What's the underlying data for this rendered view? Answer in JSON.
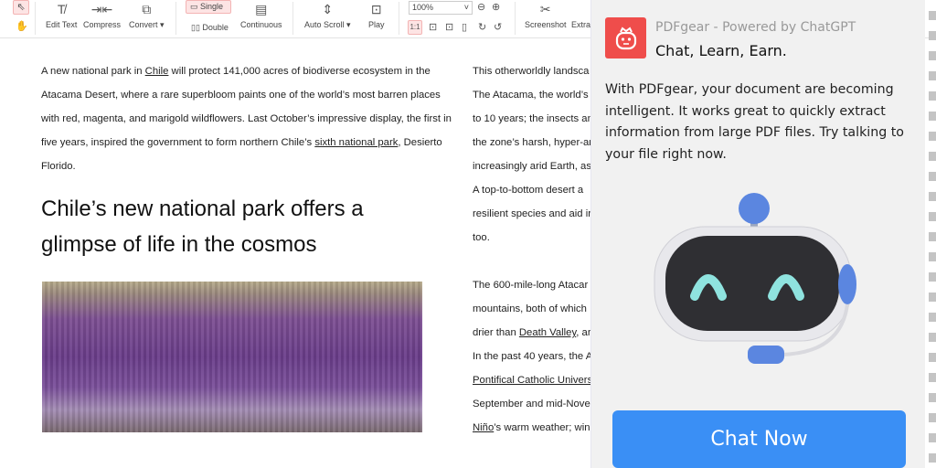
{
  "toolbar": {
    "edit_text": "Edit Text",
    "compress": "Compress",
    "convert": "Convert ▾",
    "single": "Single",
    "double": "Double",
    "continuous": "Continuous",
    "auto_scroll": "Auto Scroll ▾",
    "play": "Play",
    "zoom": "100%",
    "screenshot": "Screenshot",
    "extract": "Extra"
  },
  "doc": {
    "col1": [
      "A new national park in ",
      "Chile",
      " will protect 141,000 acres of biodiverse ecosystem in the Atacama Desert, where a rare superbloom paints one of the world’s most barren places with red, magenta, and marigold wildflowers. Last October’s impressive display, the first in five years, inspired the government to form northern Chile’s ",
      "sixth national park",
      ", Desierto Florido."
    ],
    "heading": "Chile’s new national park offers a glimpse of life in the cosmos",
    "col2": [
      "This otherworldly landsca",
      "The Atacama, the world’s",
      "to 10 years; the insects an",
      "the zone’s harsh, hyper-ar",
      "increasingly arid Earth, as",
      "A top-to-bottom desert a",
      "resilient species and aid ir",
      "too.",
      "",
      "The 600-mile-long Atacar",
      "mountains, both of which",
      "drier than ",
      "Death Valley",
      ", ar",
      "In the past 40 years, the A",
      "Pontifical Catholic Univers",
      "September and mid-Nove",
      "Niño",
      "’s warm weather; win"
    ]
  },
  "panel": {
    "title": "PDFgear - Powered by ChatGPT",
    "subtitle": "Chat, Learn, Earn.",
    "description": "With PDFgear, your document are becoming intelligent. It works great to quickly extract information from large PDF files. Try talking to your file right now.",
    "button": "Chat Now",
    "accent": "#3a8ff5",
    "logo_color": "#ef4d4b"
  }
}
